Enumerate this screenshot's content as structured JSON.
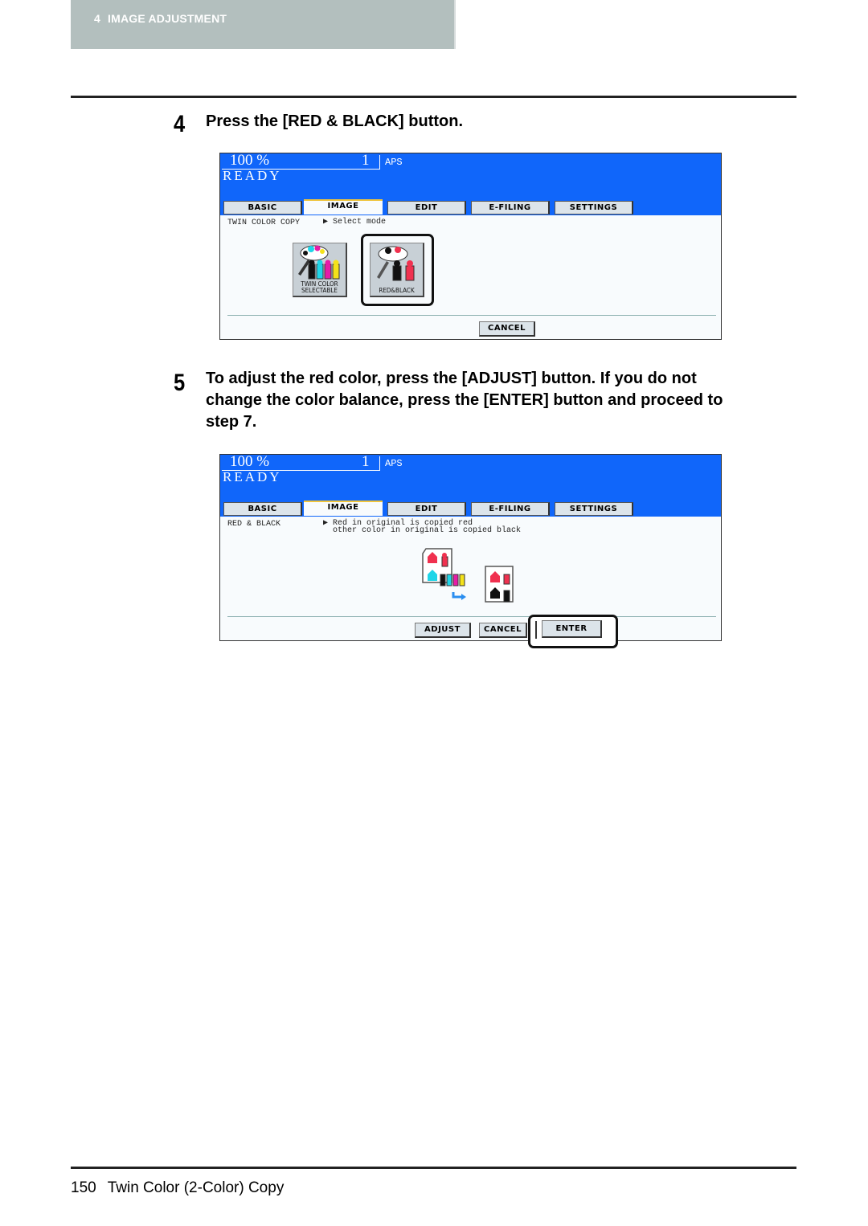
{
  "header": {
    "chapter_number": "4",
    "chapter_title": "IMAGE ADJUSTMENT"
  },
  "steps": [
    {
      "number": "4",
      "text": "Press the [RED & BLACK] button.",
      "screen": {
        "zoom": "100 %",
        "count": "1",
        "paper": "APS",
        "status": "READY",
        "tabs": [
          {
            "label": "BASIC",
            "active": false
          },
          {
            "label": "IMAGE",
            "active": true
          },
          {
            "label": "EDIT",
            "active": false
          },
          {
            "label": "E-FILING",
            "active": false
          },
          {
            "label": "SETTINGS",
            "active": false
          }
        ],
        "mode_label": "TWIN COLOR COPY",
        "message": "▶ Select mode",
        "options": [
          {
            "label_line1": "TWIN COLOR",
            "label_line2": "SELECTABLE",
            "selected": false
          },
          {
            "label_line1": "RED&BLACK",
            "label_line2": "",
            "selected": true
          }
        ],
        "buttons": [
          {
            "label": "CANCEL"
          }
        ]
      }
    },
    {
      "number": "5",
      "text_lines": [
        "To adjust the red color, press the [ADJUST] button. If you do not",
        "change the color balance, press the [ENTER] button and proceed to",
        "step 7."
      ],
      "screen": {
        "zoom": "100 %",
        "count": "1",
        "paper": "APS",
        "status": "READY",
        "tabs": [
          {
            "label": "BASIC",
            "active": false
          },
          {
            "label": "IMAGE",
            "active": true
          },
          {
            "label": "EDIT",
            "active": false
          },
          {
            "label": "E-FILING",
            "active": false
          },
          {
            "label": "SETTINGS",
            "active": false
          }
        ],
        "mode_label": "RED & BLACK",
        "message": "▶ Red in original is copied red\n  other color in original is copied black",
        "illustration": "red-black-conversion-icon",
        "buttons": [
          {
            "label": "ADJUST"
          },
          {
            "label": "CANCEL"
          },
          {
            "label": "ENTER",
            "highlighted": true
          }
        ]
      }
    }
  ],
  "footer": {
    "page_number": "150",
    "section_title": "Twin Color (2-Color) Copy"
  },
  "colors": {
    "screen_blue": "#1066fa",
    "header_band": "#b3bfbe",
    "active_tab_accent": "#f0c43a"
  }
}
